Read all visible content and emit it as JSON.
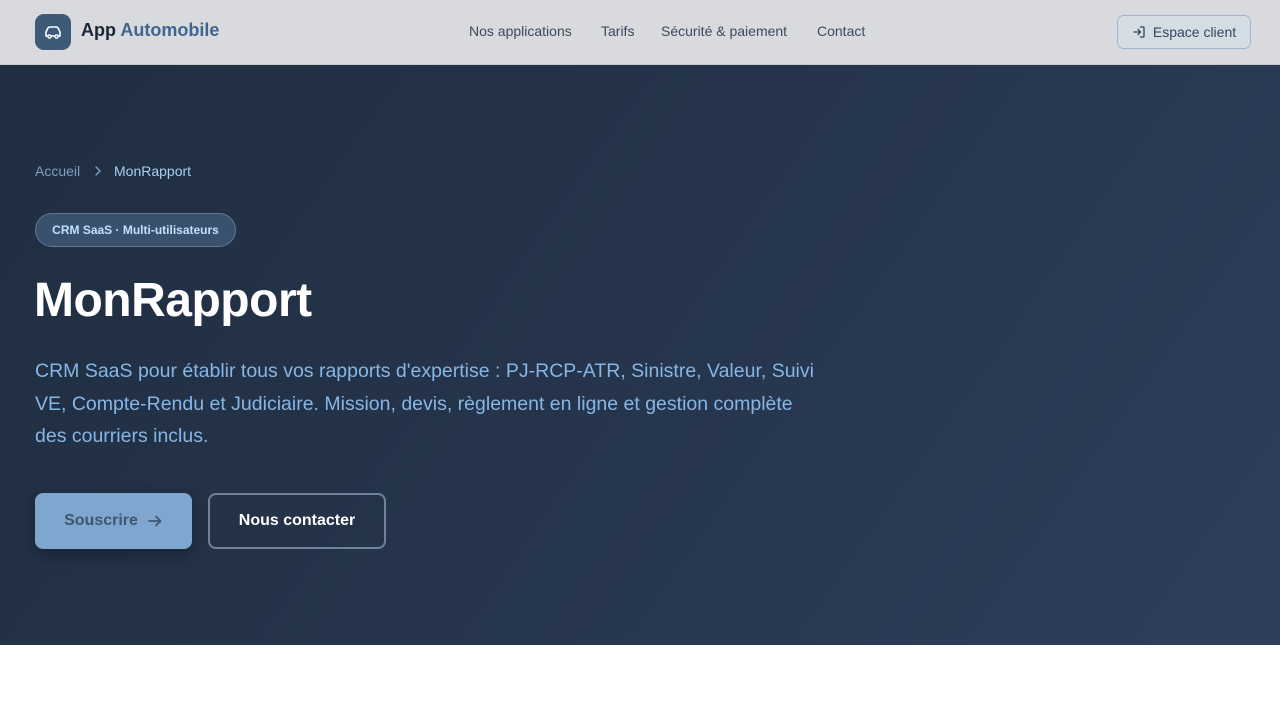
{
  "header": {
    "brand_primary": "App",
    "brand_accent": "Automobile",
    "logo_icon": "car-icon",
    "nav": [
      {
        "label": "Nos applications"
      },
      {
        "label": "Tarifs"
      },
      {
        "label": "Sécurité & paiement"
      },
      {
        "label": "Contact"
      }
    ],
    "client_button": {
      "label": "Espace client",
      "icon": "login-arrow-icon"
    }
  },
  "hero": {
    "breadcrumb": {
      "home": "Accueil",
      "separator_icon": "chevron-right-icon",
      "current": "MonRapport"
    },
    "badge": "CRM SaaS · Multi-utilisateurs",
    "title": "MonRapport",
    "description": "CRM SaaS pour établir tous vos rapports d'expertise : PJ-RCP-ATR, Sinistre, Valeur, Suivi VE, Compte-Rendu et Judiciaire. Mission, devis, règlement en ligne et gestion complète des courriers inclus.",
    "primary_button": {
      "label": "Souscrire",
      "icon": "arrow-right-icon"
    },
    "secondary_button": {
      "label": "Nous contacter"
    }
  },
  "colors": {
    "header_bg": "#d8dadd",
    "hero_bg_start": "#202e41",
    "hero_bg_end": "#2d3f5b",
    "accent": "#3f6590",
    "primary_button": "#7fa6cf",
    "description_text": "#86b6e6"
  }
}
